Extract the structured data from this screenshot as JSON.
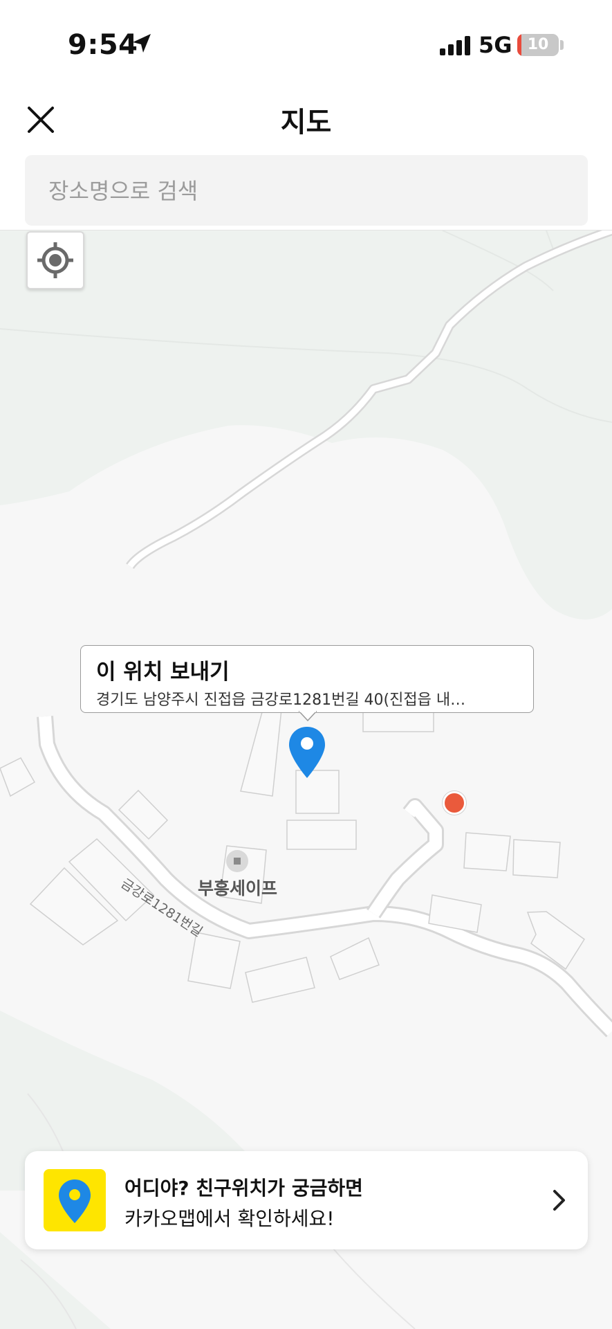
{
  "status_bar": {
    "time": "9:54",
    "network": "5G",
    "battery": "10",
    "battery_fraction": 0.1
  },
  "header": {
    "title": "지도",
    "close_icon": "close-icon"
  },
  "search": {
    "placeholder": "장소명으로 검색"
  },
  "map": {
    "gps_icon": "current-location-icon",
    "callout": {
      "title": "이 위치 보내기",
      "address": "경기도 남양주시 진접읍 금강로1281번길 40(진접읍 내…"
    },
    "poi": {
      "label": "부흥세이프"
    },
    "road_label": "금강로1281번길"
  },
  "banner": {
    "line1": "어디야? 친구위치가 궁금하면",
    "line2": "카카오맵에서 확인하세요!",
    "icon": "kakaomap-pin-icon",
    "accent": "#FEE500"
  },
  "colors": {
    "pin": "#1E88E5",
    "marker": "#EA5A3C"
  }
}
